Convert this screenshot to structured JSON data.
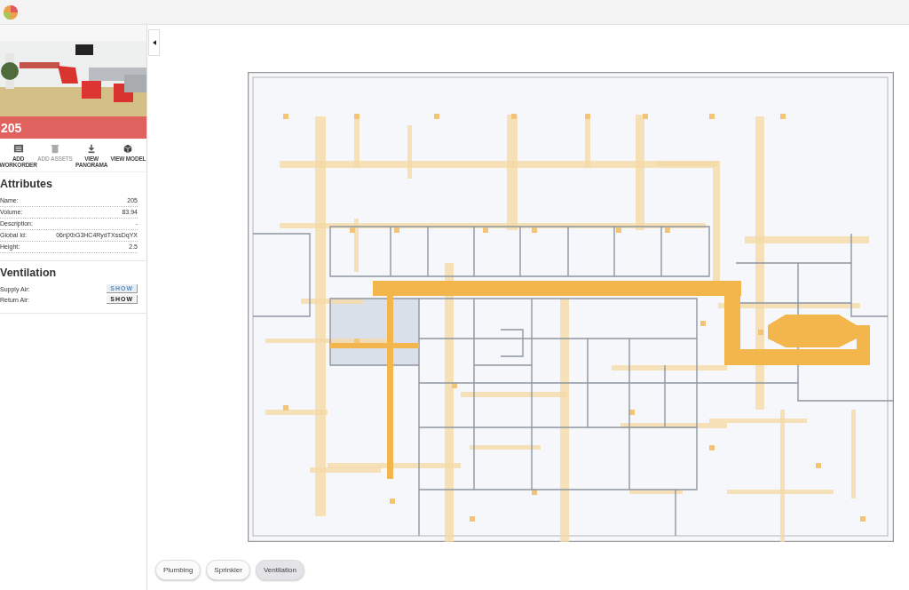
{
  "room": {
    "number": "205"
  },
  "actions": [
    {
      "kind": "workorder",
      "label": "ADD WORKORDER",
      "disabled": false
    },
    {
      "kind": "assets",
      "label": "ADD ASSETS",
      "disabled": true
    },
    {
      "kind": "panorama",
      "label": "VIEW PANORAMA",
      "disabled": false
    },
    {
      "kind": "model",
      "label": "VIEW MODEL",
      "disabled": false
    }
  ],
  "attributes": {
    "title": "Attributes",
    "rows": [
      {
        "label": "Name:",
        "value": "205"
      },
      {
        "label": "Volume:",
        "value": "83.94"
      },
      {
        "label": "Description:",
        "value": "-"
      },
      {
        "label": "Global Id:",
        "value": "06njXbG3HC4RydTXssDqYX"
      },
      {
        "label": "Height:",
        "value": "2.5"
      }
    ]
  },
  "ventilation": {
    "title": "Ventilation",
    "rows": [
      {
        "label": "Supply Air:",
        "button": "SHOW",
        "hovered": true
      },
      {
        "label": "Return Air:",
        "button": "SHOW",
        "hovered": false
      }
    ]
  },
  "layers": [
    {
      "label": "Plumbing",
      "selected": false
    },
    {
      "label": "Sprinkler",
      "selected": false
    },
    {
      "label": "Ventilation",
      "selected": true
    }
  ]
}
